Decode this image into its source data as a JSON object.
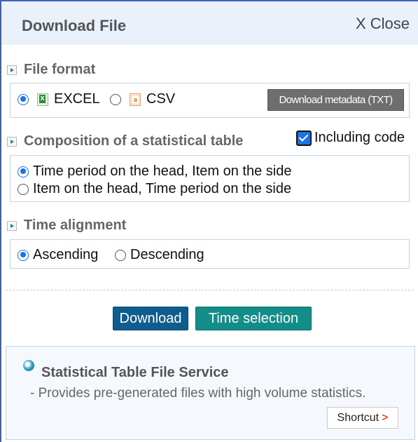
{
  "dialog": {
    "title": "Download File",
    "close_label": "X Close"
  },
  "file_format": {
    "heading": "File format",
    "options": [
      {
        "label": "EXCEL",
        "icon": "excel-file-icon",
        "selected": true
      },
      {
        "label": "CSV",
        "icon": "csv-file-icon",
        "selected": false
      }
    ],
    "metadata_button": "Download metadata (TXT)"
  },
  "composition": {
    "heading": "Composition of a statistical table",
    "including_code_label": "Including code",
    "including_code_checked": true,
    "options": [
      {
        "label": "Time period on the head, Item on the side",
        "selected": true
      },
      {
        "label": "Item on the head, Time period on the side",
        "selected": false
      }
    ]
  },
  "time_alignment": {
    "heading": "Time alignment",
    "options": [
      {
        "label": "Ascending",
        "selected": true
      },
      {
        "label": "Descending",
        "selected": false
      }
    ]
  },
  "actions": {
    "download": "Download",
    "time_selection": "Time selection"
  },
  "service": {
    "title": "Statistical Table File Service",
    "description": "- Provides pre-generated files with high volume statistics.",
    "shortcut_label": "Shortcut",
    "shortcut_arrow": ">"
  },
  "colors": {
    "header_bg": "#eaf1fb",
    "download_button": "#0f5d8e",
    "time_selection_button": "#138d87",
    "radio_accent": "#1a73e8"
  }
}
